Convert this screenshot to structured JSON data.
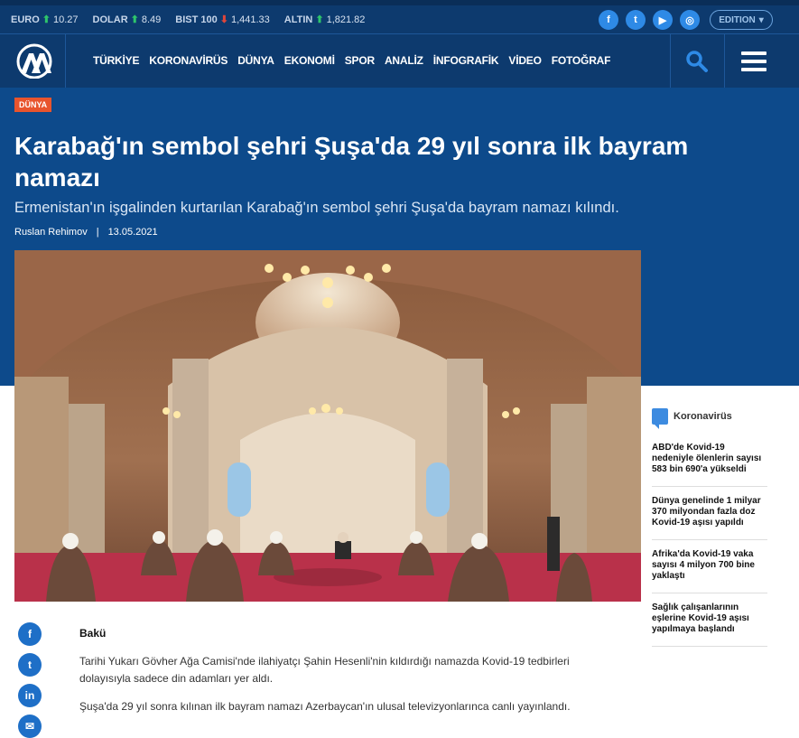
{
  "ticker": [
    {
      "label": "EURO",
      "dir": "up",
      "arrow": "⬆",
      "value": "10.27"
    },
    {
      "label": "DOLAR",
      "dir": "up",
      "arrow": "⬆",
      "value": "8.49"
    },
    {
      "label": "BIST 100",
      "dir": "down",
      "arrow": "⬇",
      "value": "1,441.33"
    },
    {
      "label": "ALTIN",
      "dir": "up",
      "arrow": "⬆",
      "value": "1,821.82"
    }
  ],
  "socials": [
    {
      "name": "facebook-icon",
      "glyph": "f"
    },
    {
      "name": "twitter-icon",
      "glyph": "t"
    },
    {
      "name": "youtube-icon",
      "glyph": "▶"
    },
    {
      "name": "instagram-icon",
      "glyph": "◎"
    }
  ],
  "edition": {
    "label": "EDITION",
    "caret": "▾"
  },
  "menu": [
    "TÜRKİYE",
    "KORONAVİRÜS",
    "DÜNYA",
    "EKONOMİ",
    "SPOR",
    "ANALİZ",
    "İNFOGRAFİK",
    "VİDEO",
    "FOTOĞRAF"
  ],
  "article": {
    "category": "DÜNYA",
    "title": "Karabağ'ın sembol şehri Şuşa'da 29 yıl sonra ilk bayram namazı",
    "subtitle": "Ermenistan'ın işgalinden kurtarılan Karabağ'ın sembol şehri Şuşa'da bayram namazı kılındı.",
    "author": "Ruslan Rehimov",
    "separator": "|",
    "date": "13.05.2021",
    "location": "Bakü",
    "paragraphs": [
      "Tarihi Yukarı Gövher Ağa Camisi'nde ilahiyatçı Şahin Hesenli'nin kıldırdığı namazda Kovid-19 tedbirleri dolayısıyla sadece din adamları yer aldı.",
      "Şuşa'da 29 yıl sonra kılınan ilk bayram namazı Azerbaycan'ın ulusal televizyonlarınca canlı yayınlandı."
    ]
  },
  "share": [
    {
      "name": "share-facebook-icon",
      "glyph": "f"
    },
    {
      "name": "share-twitter-icon",
      "glyph": "t"
    },
    {
      "name": "share-linkedin-icon",
      "glyph": "in"
    },
    {
      "name": "share-email-icon",
      "glyph": "✉"
    }
  ],
  "sidebar": {
    "heading": "Koronavirüs",
    "items": [
      "ABD'de Kovid-19 nedeniyle ölenlerin sayısı 583 bin 690'a yükseldi",
      "Dünya genelinde 1 milyar 370 milyondan fazla doz Kovid-19 aşısı yapıldı",
      "Afrika'da Kovid-19 vaka sayısı 4 milyon 700 bine yaklaştı",
      "Sağlık çalışanlarının eşlerine Kovid-19 aşısı yapılmaya başlandı"
    ]
  },
  "colors": {
    "navy": "#0d3a6e",
    "hero": "#0d4a8b",
    "badge": "#e8542d",
    "accent": "#2e8ae6"
  }
}
